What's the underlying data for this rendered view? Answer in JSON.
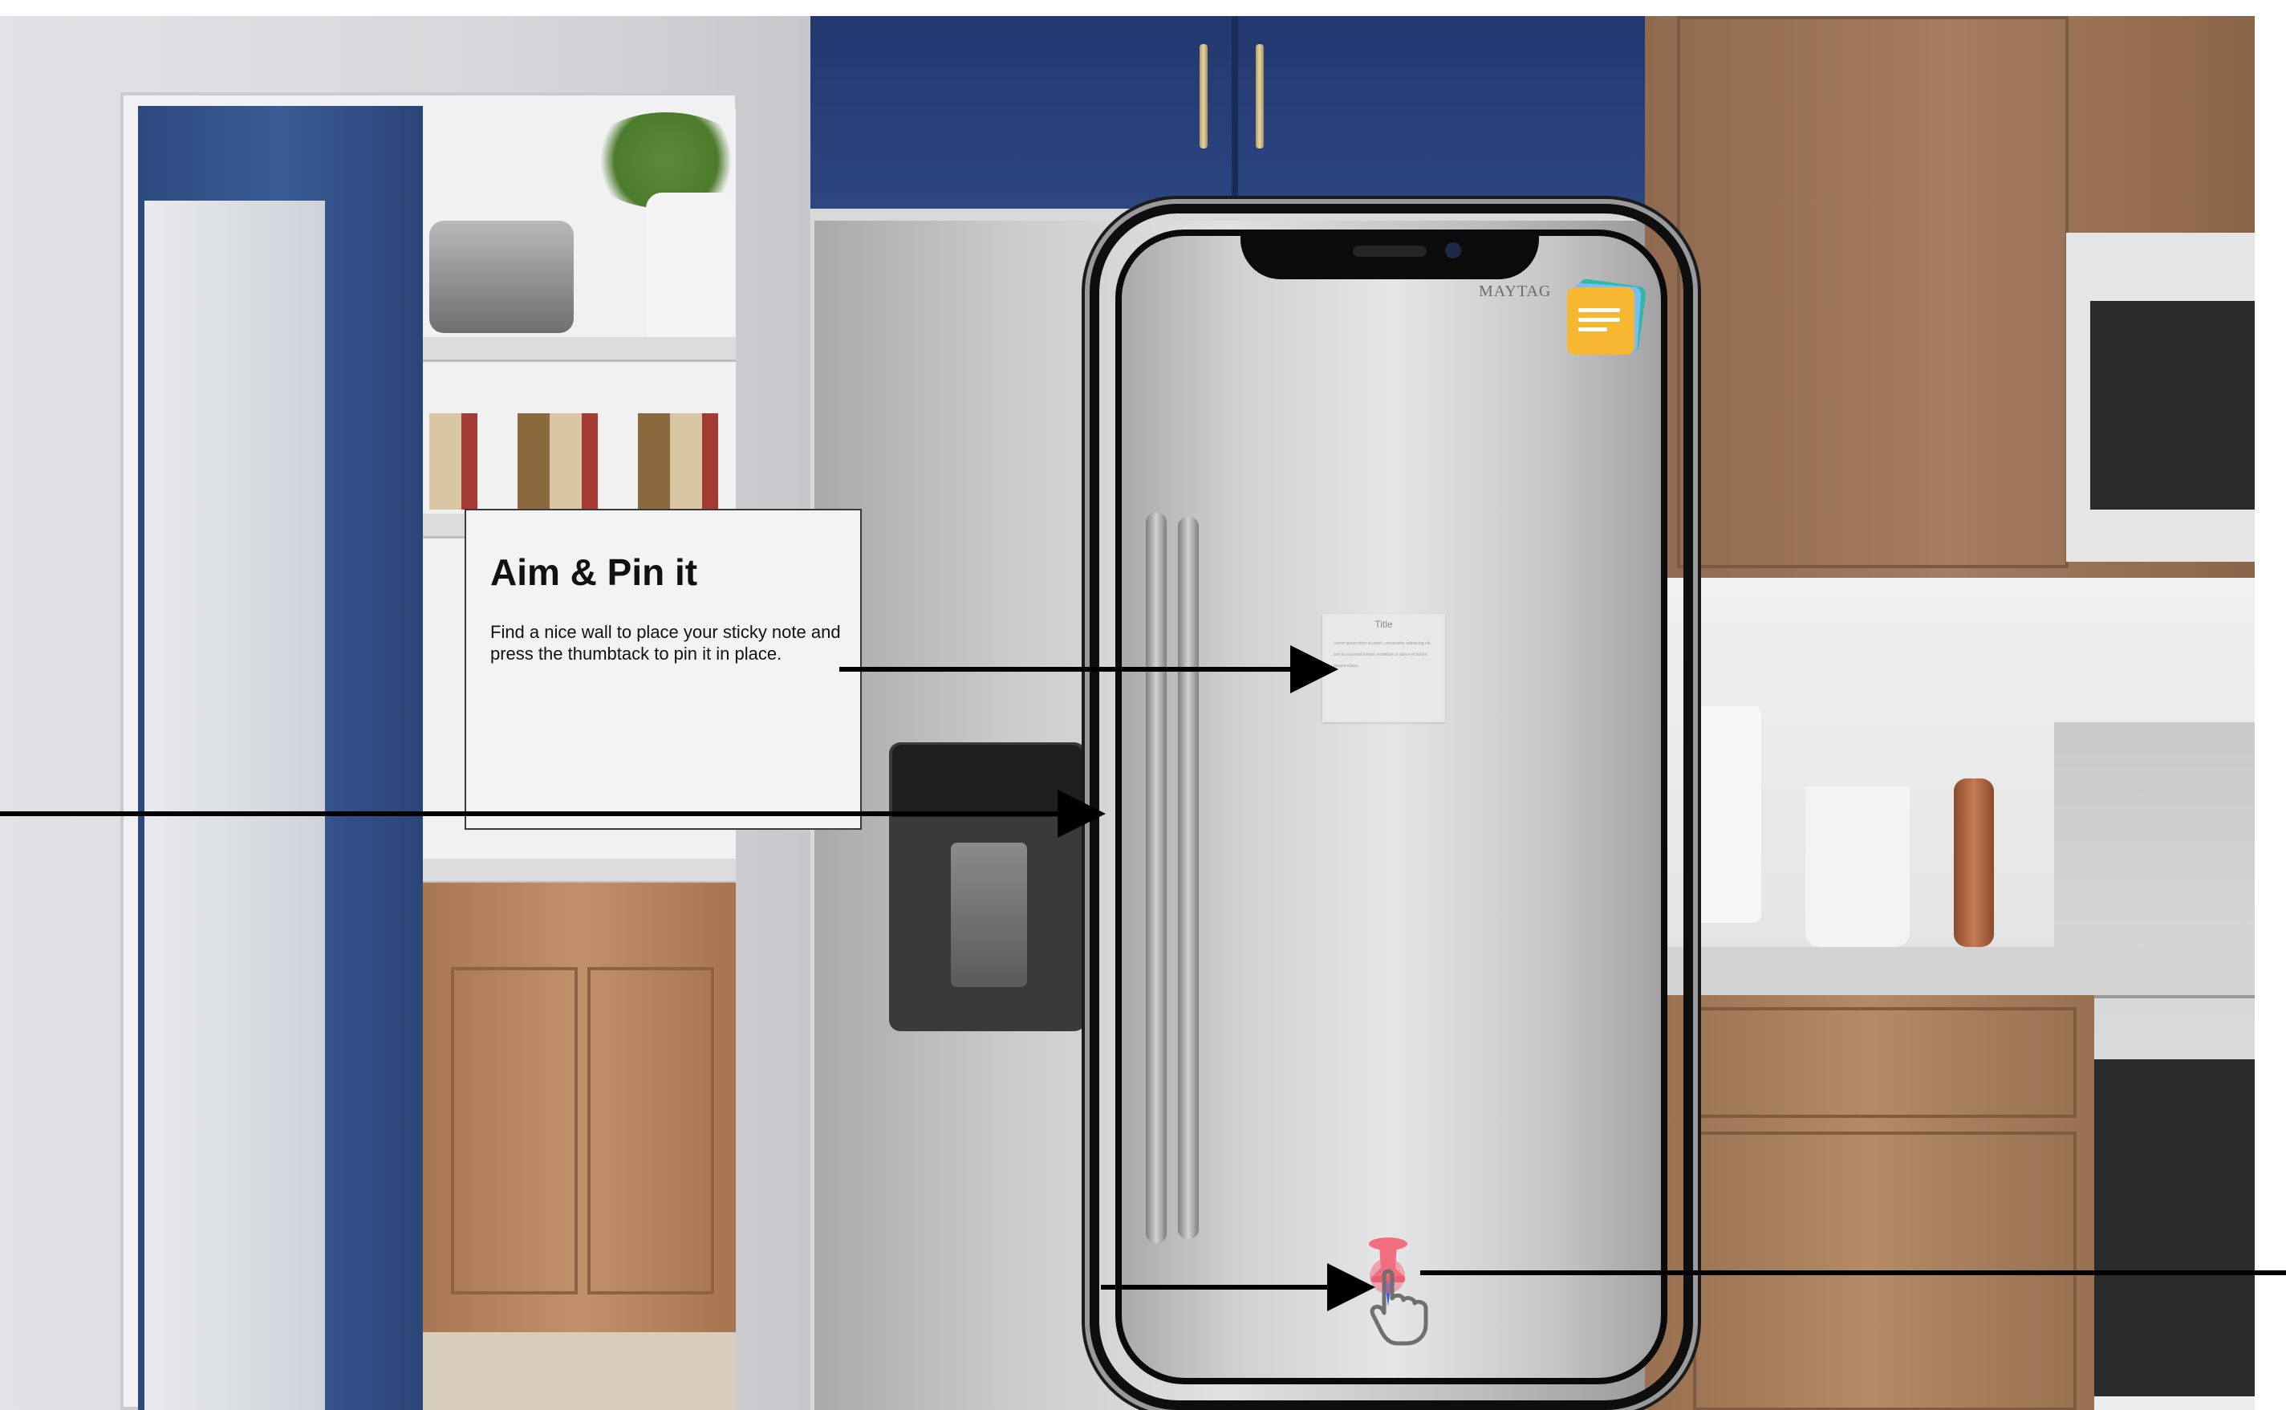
{
  "tutorial": {
    "title": "Aim & Pin it",
    "body": "Find a nice wall to place your sticky note and press the thumbtack to pin it in place."
  },
  "scene": {
    "fridge_brand": "MAYTAG",
    "description_icons": [
      "sticky-notes-stack-icon",
      "thumbtack-icon",
      "tap-hand-icon"
    ]
  },
  "sticky_note_preview": {
    "title": "Title",
    "body": "Lorem ipsum dolor sit amet, consectetur adipiscing elit, sed do eiusmod tempor incididunt ut labore et dolore magna aliqua."
  },
  "colors": {
    "callout_bg": "#f3f3f3",
    "note_yellow": "#f7b731",
    "pin_pink": "#f26d7d",
    "pin_blue": "#3b5bdb",
    "arrow": "#000000"
  }
}
